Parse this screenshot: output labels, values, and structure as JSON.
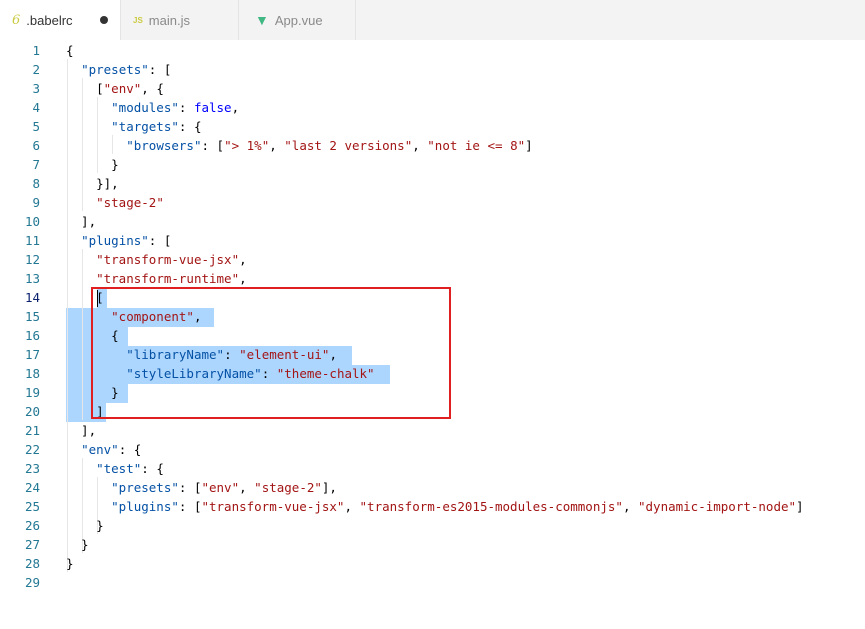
{
  "tabs": [
    {
      "label": ".babelrc",
      "icon": "babel-icon",
      "glyph": "6",
      "dirty": true,
      "active": true
    },
    {
      "label": "main.js",
      "icon": "js-file-icon",
      "glyph": "JS",
      "active": false
    },
    {
      "label": "App.vue",
      "icon": "vue-file-icon",
      "glyph": "▼",
      "active": false
    }
  ],
  "editor": {
    "current_line": 14,
    "highlight_lines": [
      14,
      20
    ],
    "lines": [
      "1",
      "2",
      "3",
      "4",
      "5",
      "6",
      "7",
      "8",
      "9",
      "10",
      "11",
      "12",
      "13",
      "14",
      "15",
      "16",
      "17",
      "18",
      "19",
      "20",
      "21",
      "22",
      "23",
      "24",
      "25",
      "26",
      "27",
      "28",
      "29"
    ],
    "code": [
      [
        {
          "t": "{",
          "c": "p"
        }
      ],
      [
        {
          "t": "  ",
          "c": "p"
        },
        {
          "t": "\"presets\"",
          "c": "k"
        },
        {
          "t": ": [",
          "c": "p"
        }
      ],
      [
        {
          "t": "    [",
          "c": "p"
        },
        {
          "t": "\"env\"",
          "c": "s"
        },
        {
          "t": ", {",
          "c": "p"
        }
      ],
      [
        {
          "t": "      ",
          "c": "p"
        },
        {
          "t": "\"modules\"",
          "c": "k"
        },
        {
          "t": ": ",
          "c": "p"
        },
        {
          "t": "false",
          "c": "b"
        },
        {
          "t": ",",
          "c": "p"
        }
      ],
      [
        {
          "t": "      ",
          "c": "p"
        },
        {
          "t": "\"targets\"",
          "c": "k"
        },
        {
          "t": ": {",
          "c": "p"
        }
      ],
      [
        {
          "t": "        ",
          "c": "p"
        },
        {
          "t": "\"browsers\"",
          "c": "k"
        },
        {
          "t": ": [",
          "c": "p"
        },
        {
          "t": "\"> 1%\"",
          "c": "s"
        },
        {
          "t": ", ",
          "c": "p"
        },
        {
          "t": "\"last 2 versions\"",
          "c": "s"
        },
        {
          "t": ", ",
          "c": "p"
        },
        {
          "t": "\"not ie <= 8\"",
          "c": "s"
        },
        {
          "t": "]",
          "c": "p"
        }
      ],
      [
        {
          "t": "      }",
          "c": "p"
        }
      ],
      [
        {
          "t": "    }],",
          "c": "p"
        }
      ],
      [
        {
          "t": "    ",
          "c": "p"
        },
        {
          "t": "\"stage-2\"",
          "c": "s"
        }
      ],
      [
        {
          "t": "  ],",
          "c": "p"
        }
      ],
      [
        {
          "t": "  ",
          "c": "p"
        },
        {
          "t": "\"plugins\"",
          "c": "k"
        },
        {
          "t": ": [",
          "c": "p"
        }
      ],
      [
        {
          "t": "    ",
          "c": "p"
        },
        {
          "t": "\"transform-vue-jsx\"",
          "c": "s"
        },
        {
          "t": ",",
          "c": "p"
        }
      ],
      [
        {
          "t": "    ",
          "c": "p"
        },
        {
          "t": "\"transform-runtime\"",
          "c": "s"
        },
        {
          "t": ",",
          "c": "p"
        }
      ],
      [
        {
          "t": "    [",
          "c": "p"
        }
      ],
      [
        {
          "t": "      ",
          "c": "p"
        },
        {
          "t": "\"component\"",
          "c": "s"
        },
        {
          "t": ",",
          "c": "p"
        }
      ],
      [
        {
          "t": "      {",
          "c": "p"
        }
      ],
      [
        {
          "t": "        ",
          "c": "p"
        },
        {
          "t": "\"libraryName\"",
          "c": "k"
        },
        {
          "t": ": ",
          "c": "p"
        },
        {
          "t": "\"element-ui\"",
          "c": "s"
        },
        {
          "t": ",",
          "c": "p"
        }
      ],
      [
        {
          "t": "        ",
          "c": "p"
        },
        {
          "t": "\"styleLibraryName\"",
          "c": "k"
        },
        {
          "t": ": ",
          "c": "p"
        },
        {
          "t": "\"theme-chalk\"",
          "c": "s"
        }
      ],
      [
        {
          "t": "      }",
          "c": "p"
        }
      ],
      [
        {
          "t": "    ]",
          "c": "p"
        }
      ],
      [
        {
          "t": "  ],",
          "c": "p"
        }
      ],
      [
        {
          "t": "  ",
          "c": "p"
        },
        {
          "t": "\"env\"",
          "c": "k"
        },
        {
          "t": ": {",
          "c": "p"
        }
      ],
      [
        {
          "t": "    ",
          "c": "p"
        },
        {
          "t": "\"test\"",
          "c": "k"
        },
        {
          "t": ": {",
          "c": "p"
        }
      ],
      [
        {
          "t": "      ",
          "c": "p"
        },
        {
          "t": "\"presets\"",
          "c": "k"
        },
        {
          "t": ": [",
          "c": "p"
        },
        {
          "t": "\"env\"",
          "c": "s"
        },
        {
          "t": ", ",
          "c": "p"
        },
        {
          "t": "\"stage-2\"",
          "c": "s"
        },
        {
          "t": "],",
          "c": "p"
        }
      ],
      [
        {
          "t": "      ",
          "c": "p"
        },
        {
          "t": "\"plugins\"",
          "c": "k"
        },
        {
          "t": ": [",
          "c": "p"
        },
        {
          "t": "\"transform-vue-jsx\"",
          "c": "s"
        },
        {
          "t": ", ",
          "c": "p"
        },
        {
          "t": "\"transform-es2015-modules-commonjs\"",
          "c": "s"
        },
        {
          "t": ", ",
          "c": "p"
        },
        {
          "t": "\"dynamic-import-node\"",
          "c": "s"
        },
        {
          "t": "]",
          "c": "p"
        }
      ],
      [
        {
          "t": "    }",
          "c": "p"
        }
      ],
      [
        {
          "t": "  }",
          "c": "p"
        }
      ],
      [
        {
          "t": "}",
          "c": "p"
        }
      ],
      [
        {
          "t": "",
          "c": "p"
        }
      ]
    ]
  }
}
